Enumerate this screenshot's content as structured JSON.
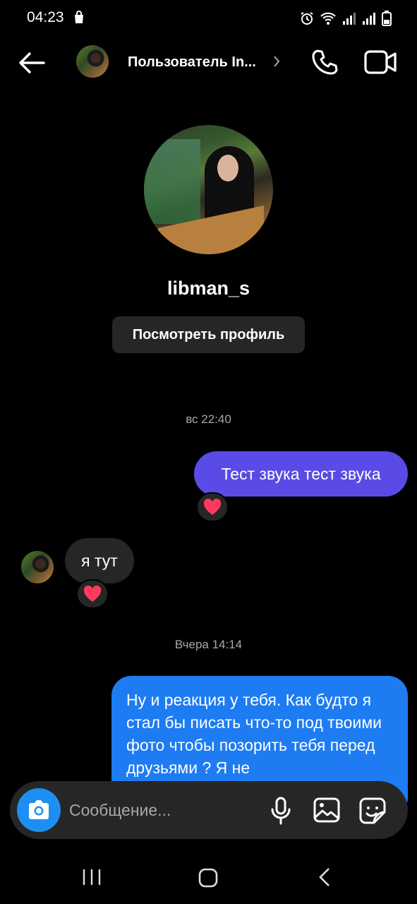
{
  "status_bar": {
    "time": "04:23"
  },
  "header": {
    "title": "Пользователь In...",
    "icons": [
      "back-arrow-icon",
      "chevron-right-icon",
      "phone-icon",
      "video-camera-icon"
    ]
  },
  "profile": {
    "username": "libman_s",
    "view_profile_label": "Посмотреть профиль"
  },
  "conversation": {
    "timestamps": [
      "вс 22:40",
      "Вчера 14:14"
    ],
    "messages": [
      {
        "direction": "outgoing",
        "text": "Тест звука тест звука",
        "reaction": "heart"
      },
      {
        "direction": "incoming",
        "text": "я тут",
        "reaction": "heart"
      },
      {
        "direction": "outgoing",
        "text": "Ну и реакция у тебя. Как будто я стал бы писать что-то под твоими фото чтобы позорить тебя перед друзьями ? Я не"
      }
    ]
  },
  "composer": {
    "placeholder": "Сообщение...",
    "icons": [
      "camera-icon",
      "microphone-icon",
      "gallery-icon",
      "sticker-icon"
    ]
  },
  "colors": {
    "background": "#000000",
    "bubble_outgoing_1": "#5b4be6",
    "bubble_outgoing_2": "#1d7cf2",
    "bubble_incoming": "#262626",
    "camera_button": "#1d8ff2",
    "heart": "#ff3a5e"
  }
}
